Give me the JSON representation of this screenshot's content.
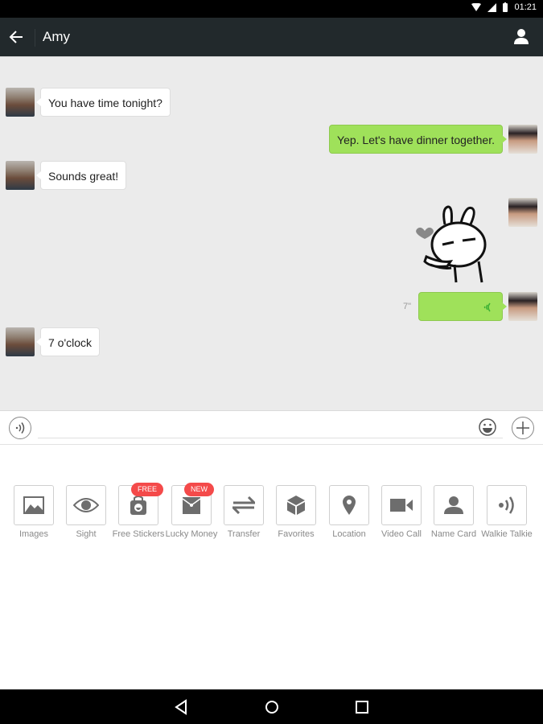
{
  "status_bar": {
    "time": "01:21",
    "icons": [
      "wifi-icon",
      "signal-icon",
      "battery-icon"
    ]
  },
  "header": {
    "title": "Amy",
    "back_icon": "arrow-left-icon",
    "profile_icon": "person-icon"
  },
  "messages": [
    {
      "direction": "incoming",
      "type": "text",
      "text": "You have time tonight?"
    },
    {
      "direction": "outgoing",
      "type": "text",
      "text": "Yep. Let's have dinner together."
    },
    {
      "direction": "incoming",
      "type": "text",
      "text": "Sounds great!"
    },
    {
      "direction": "outgoing",
      "type": "sticker",
      "sticker": "rabbit-blowing-kiss-sticker"
    },
    {
      "direction": "outgoing",
      "type": "voice",
      "duration": "7\""
    },
    {
      "direction": "incoming",
      "type": "text",
      "text": "7 o'clock"
    }
  ],
  "input_bar": {
    "voice_icon": "voice-icon",
    "placeholder": "",
    "value": "",
    "emoji_icon": "emoji-icon",
    "plus_icon": "plus-icon"
  },
  "tools": [
    {
      "label": "Images",
      "icon": "image-icon"
    },
    {
      "label": "Sight",
      "icon": "eye-icon"
    },
    {
      "label": "Free Stickers",
      "icon": "sticker-bag-icon",
      "badge": "FREE"
    },
    {
      "label": "Lucky Money",
      "icon": "red-envelope-icon",
      "badge": "NEW"
    },
    {
      "label": "Transfer",
      "icon": "transfer-icon"
    },
    {
      "label": "Favorites",
      "icon": "box-icon"
    },
    {
      "label": "Location",
      "icon": "location-pin-icon"
    },
    {
      "label": "Video Call",
      "icon": "video-camera-icon"
    },
    {
      "label": "Name Card",
      "icon": "person-icon"
    },
    {
      "label": "Walkie Talkie",
      "icon": "walkie-talkie-icon"
    }
  ],
  "colors": {
    "header_bg": "#22292c",
    "chat_bg": "#ebebeb",
    "outgoing_bubble": "#9fe15a",
    "badge": "#f44a4a",
    "icon_gray": "#6d6d6d"
  }
}
